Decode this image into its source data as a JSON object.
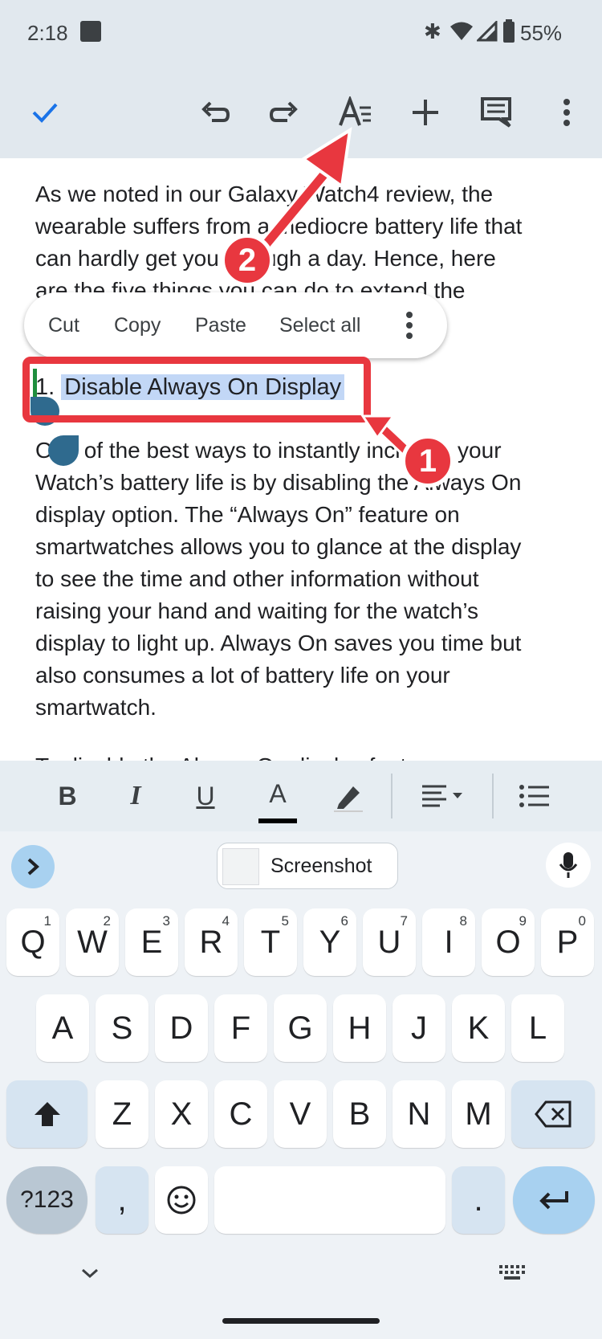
{
  "status": {
    "time": "2:18",
    "battery": "55%"
  },
  "toolbar": {
    "done_icon": "check-icon",
    "undo_icon": "undo-icon",
    "redo_icon": "redo-icon",
    "format_icon": "text-format-icon",
    "insert_icon": "plus-icon",
    "comment_icon": "comment-icon",
    "more_icon": "more-vert-icon"
  },
  "document": {
    "lines_before": [
      "As we noted in our Galaxy Watch4 review, the",
      "wearable suffers from a mediocre battery life that",
      "can hardly get you through a day. Hence, here",
      "are the five things you can do to extend the"
    ],
    "heading_number": "1.",
    "heading_text": "Disable Always On Display",
    "lines_after": [
      "One of the best ways to instantly increase your",
      "Watch’s battery life is by disabling the Always On",
      "display option. The “Always On” feature on",
      "smartwatches allows you to glance at the display",
      "to see the time and other information without",
      "raising your hand and waiting for the watch’s",
      "display to light up. Always On saves you time but",
      "also consumes a lot of battery life on your",
      "smartwatch."
    ],
    "cut_off_line": "To disable the Always On display feature,"
  },
  "context_menu": {
    "cut": "Cut",
    "copy": "Copy",
    "paste": "Paste",
    "select_all": "Select all"
  },
  "annotations": {
    "badge_1": "1",
    "badge_2": "2",
    "color": "#e8373f"
  },
  "format_bar": {
    "bold": "B",
    "italic": "I",
    "underline": "U",
    "text_color": "A"
  },
  "suggestion": {
    "chip_label": "Screenshot"
  },
  "keyboard": {
    "row1": [
      {
        "k": "Q",
        "h": "1"
      },
      {
        "k": "W",
        "h": "2"
      },
      {
        "k": "E",
        "h": "3"
      },
      {
        "k": "R",
        "h": "4"
      },
      {
        "k": "T",
        "h": "5"
      },
      {
        "k": "Y",
        "h": "6"
      },
      {
        "k": "U",
        "h": "7"
      },
      {
        "k": "I",
        "h": "8"
      },
      {
        "k": "O",
        "h": "9"
      },
      {
        "k": "P",
        "h": "0"
      }
    ],
    "row2": [
      "A",
      "S",
      "D",
      "F",
      "G",
      "H",
      "J",
      "K",
      "L"
    ],
    "row3": [
      "Z",
      "X",
      "C",
      "V",
      "B",
      "N",
      "M"
    ],
    "symbols": "?123",
    "comma": ",",
    "period": "."
  },
  "colors": {
    "accent": "#1a73e8",
    "selection": "#c2d7f6",
    "handle": "#2f6a8e",
    "enter": "#a8d1f0"
  }
}
